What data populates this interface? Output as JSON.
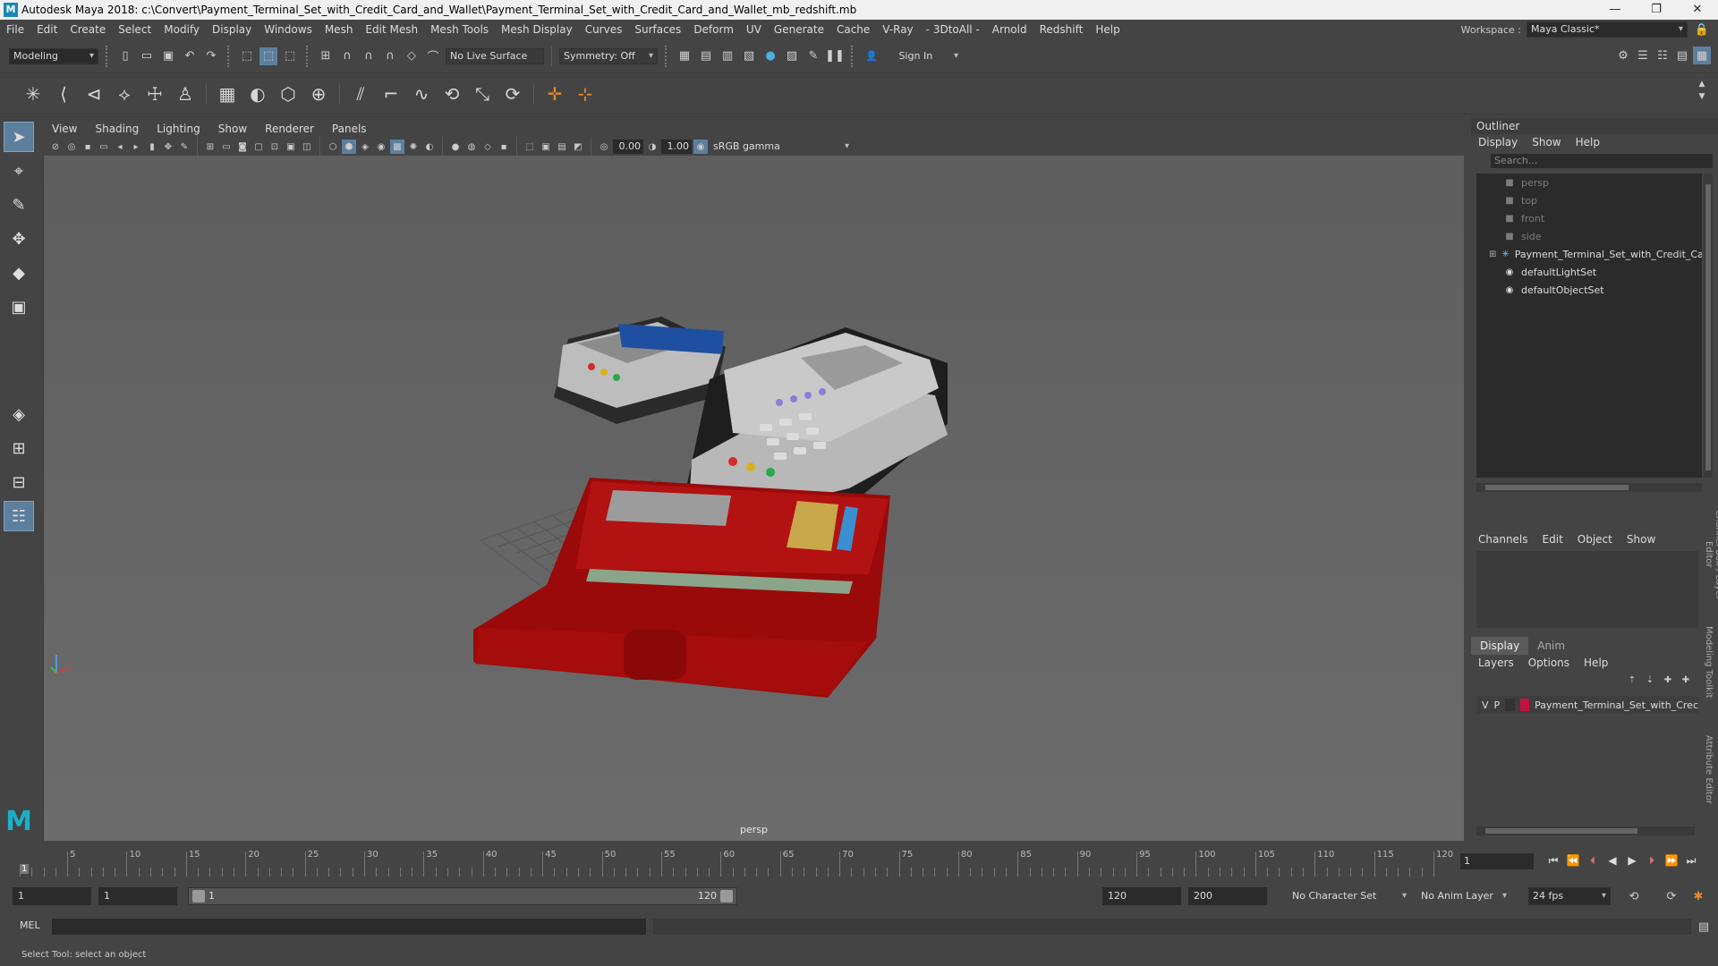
{
  "window": {
    "title": "Autodesk Maya 2018: c:\\Convert\\Payment_Terminal_Set_with_Credit_Card_and_Wallet\\Payment_Terminal_Set_with_Credit_Card_and_Wallet_mb_redshift.mb",
    "minimize": "—",
    "maximize": "❐",
    "close": "✕"
  },
  "menu": [
    "File",
    "Edit",
    "Create",
    "Select",
    "Modify",
    "Display",
    "Windows",
    "Mesh",
    "Edit Mesh",
    "Mesh Tools",
    "Mesh Display",
    "Curves",
    "Surfaces",
    "Deform",
    "UV",
    "Generate",
    "Cache",
    "V-Ray",
    "- 3DtoAll -",
    "Arnold",
    "Redshift",
    "Help"
  ],
  "workspace": {
    "label": "Workspace :",
    "value": "Maya Classic*"
  },
  "statusline": {
    "mode": "Modeling",
    "live_surface": "No Live Surface",
    "symmetry": "Symmetry: Off",
    "sign_in": "Sign In"
  },
  "viewport": {
    "menus": [
      "View",
      "Shading",
      "Lighting",
      "Show",
      "Renderer",
      "Panels"
    ],
    "exposure": "0.00",
    "gamma": "1.00",
    "color_space": "sRGB gamma",
    "camera": "persp"
  },
  "outliner": {
    "title": "Outliner",
    "menus": [
      "Display",
      "Show",
      "Help"
    ],
    "search_placeholder": "Search...",
    "items": [
      {
        "label": "persp",
        "icon": "camera-icon",
        "dim": true
      },
      {
        "label": "top",
        "icon": "camera-icon",
        "dim": true
      },
      {
        "label": "front",
        "icon": "camera-icon",
        "dim": true
      },
      {
        "label": "side",
        "icon": "camera-icon",
        "dim": true
      },
      {
        "label": "Payment_Terminal_Set_with_Credit_Card",
        "icon": "transform-icon",
        "dim": false
      },
      {
        "label": "defaultLightSet",
        "icon": "set-icon",
        "dim": false
      },
      {
        "label": "defaultObjectSet",
        "icon": "set-icon",
        "dim": false
      }
    ]
  },
  "channelbox": {
    "menus": [
      "Channels",
      "Edit",
      "Object",
      "Show"
    ]
  },
  "layereditor": {
    "tabs": [
      "Display",
      "Anim"
    ],
    "menus": [
      "Layers",
      "Options",
      "Help"
    ],
    "layer": {
      "v": "V",
      "p": "P",
      "name": "Payment_Terminal_Set_with_Crec",
      "color": "#c0143c"
    }
  },
  "sidetabs": [
    "Channel Box / Layer Editor",
    "Modeling Toolkit",
    "Attribute Editor"
  ],
  "timeslider": {
    "labels": [
      "5",
      "10",
      "15",
      "20",
      "25",
      "30",
      "35",
      "40",
      "45",
      "50",
      "55",
      "60",
      "65",
      "70",
      "75",
      "80",
      "85",
      "90",
      "95",
      "100",
      "105",
      "110",
      "115",
      "120"
    ],
    "start": "1",
    "current_frame": "1"
  },
  "range": {
    "start": "1",
    "playback_start": "1",
    "range_start": "1",
    "range_end": "120",
    "playback_end": "120",
    "end": "200",
    "character_set": "No Character Set",
    "anim_layer": "No Anim Layer",
    "fps": "24 fps"
  },
  "cmdline": {
    "label": "MEL"
  },
  "help": {
    "text": "Select Tool: select an object"
  }
}
